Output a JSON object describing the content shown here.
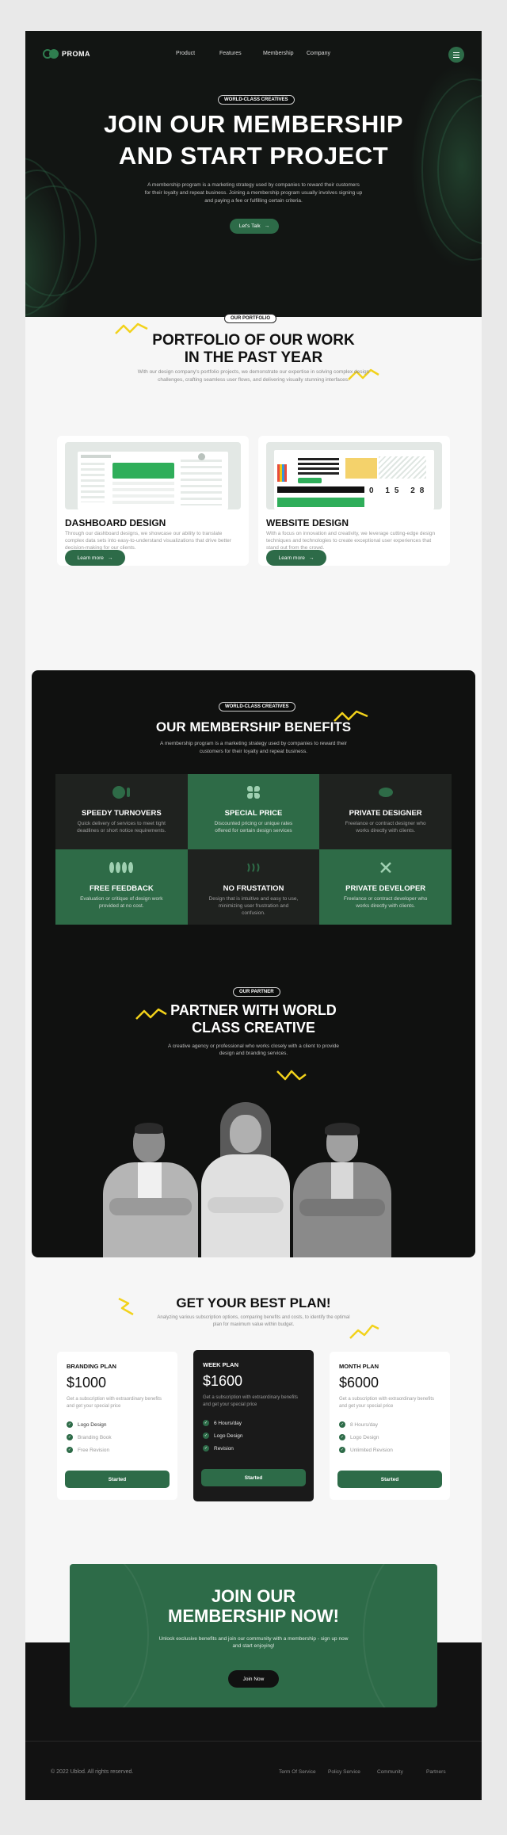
{
  "nav": {
    "brand": "PROMA",
    "links": [
      "Product",
      "Features",
      "Membership",
      "Company"
    ]
  },
  "hero": {
    "badge": "WORLD-CLASS CREATIVES",
    "title_line1": "JOIN OUR MEMBERSHIP",
    "title_line2": "AND START PROJECT",
    "subtitle": "A membership program is a marketing strategy used by companies to reward their customers for their loyalty and repeat business. Joining a membership program usually involves signing up and paying a fee or fulfilling certain criteria.",
    "cta": "Let's Talk"
  },
  "portfolio": {
    "badge": "OUR PORTFOLIO",
    "title_line1": "PORTFOLIO OF OUR WORK",
    "title_line2": "IN THE PAST YEAR",
    "subtitle": "With our design company's portfolio projects, we demonstrate our expertise in solving complex design challenges, crafting seamless user flows, and delivering visually stunning interfaces.",
    "cards": [
      {
        "title": "DASHBOARD DESIGN",
        "desc": "Through our dashboard designs, we showcase our ability to translate complex data sets into easy-to-understand visualizations that drive better decision-making for our clients.",
        "button": "Learn more"
      },
      {
        "title": "WEBSITE DESIGN",
        "desc": "With a focus on innovation and creativity, we leverage cutting-edge design techniques and technologies to create exceptional user experiences that stand out from the crowd.",
        "button": "Learn more"
      }
    ]
  },
  "benefits": {
    "badge": "WORLD-CLASS CREATIVES",
    "title": "OUR MEMBERSHIP BENEFITS",
    "subtitle": "A membership program is a marketing strategy used by companies to reward their customers for their loyalty and repeat business.",
    "items": [
      {
        "title": "SPEEDY TURNOVERS",
        "desc": "Quick delivery of services to meet tight deadlines or short notice requirements."
      },
      {
        "title": "SPECIAL PRICE",
        "desc": "Discounted pricing or unique rates offered for certain design services"
      },
      {
        "title": "PRIVATE DESIGNER",
        "desc": "Freelance or contract designer who works directly with clients."
      },
      {
        "title": "FREE FEEDBACK",
        "desc": "Evaluation or critique of design work provided at no cost."
      },
      {
        "title": "NO FRUSTATION",
        "desc": "Design that is intuitive and easy to use, minimizing user frustration and confusion."
      },
      {
        "title": "PRIVATE DEVELOPER",
        "desc": "Freelance or contract developer who works directly with clients."
      }
    ]
  },
  "partner": {
    "badge": "OUR PARTNER",
    "title_line1": "PARTNER WITH WORLD",
    "title_line2": "CLASS CREATIVE",
    "subtitle": "A creative agency or professional who works closely with a client to provide design and branding services."
  },
  "plans": {
    "title": "GET YOUR BEST PLAN!",
    "subtitle": "Analyzing various subscription options, comparing benefits and costs, to identify the optimal plan for maximum value within budget.",
    "items": [
      {
        "name": "BRANDING PLAN",
        "price": "$1000",
        "desc": "Get a subscription with extraordinary benefits and get your special price",
        "features": [
          "Logo Design",
          "Branding Book",
          "Free Revision"
        ],
        "button": "Started"
      },
      {
        "name": "WEEK PLAN",
        "price": "$1600",
        "desc": "Get a subscription with extraordinary benefits and get your special price",
        "features": [
          "6 Hours/day",
          "Logo Design",
          "Revision"
        ],
        "button": "Started"
      },
      {
        "name": "MONTH PLAN",
        "price": "$6000",
        "desc": "Get a subscription with extraordinary benefits and get your special price",
        "features": [
          "8 Hours/day",
          "Logo Design",
          "Unlimited Revision"
        ],
        "button": "Started"
      }
    ]
  },
  "cta": {
    "title_line1": "JOIN OUR",
    "title_line2": "MEMBERSHIP NOW!",
    "subtitle": "Unlock exclusive benefits and join our community with a membership - sign up now and start enjoying!",
    "button": "Join Now"
  },
  "footer": {
    "copyright": "© 2022 Ublod. All rights reserved.",
    "links": [
      "Term Of Service",
      "Policy Service",
      "Community",
      "Partners"
    ]
  },
  "colors": {
    "accent": "#2d6b48",
    "dark": "#121513",
    "highlight": "#f2d21b"
  }
}
